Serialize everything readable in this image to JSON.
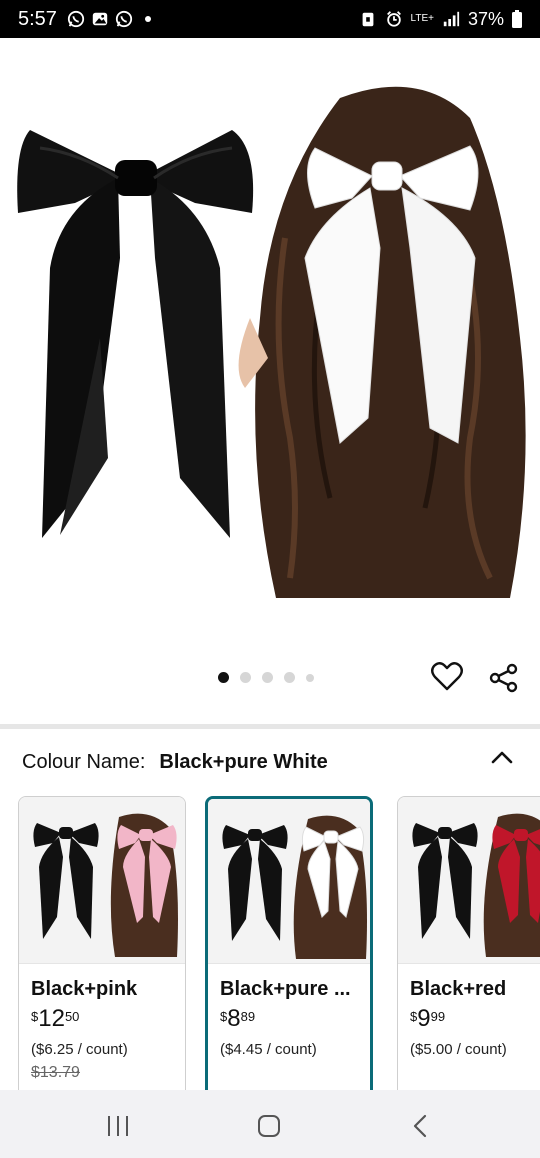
{
  "status_bar": {
    "time": "5:57",
    "network": "LTE+",
    "battery": "37%"
  },
  "carousel": {
    "total_dots": 5,
    "active_index": 0
  },
  "colour_selector": {
    "label": "Colour Name:",
    "selected_value": "Black+pure White"
  },
  "variants": [
    {
      "name": "Black+pink",
      "price_currency": "$",
      "price_whole": "12",
      "price_fraction": "50",
      "unit_price": "($6.25 / count)",
      "list_price": "$13.79",
      "bow_color": "#f2b6c8",
      "selected": false
    },
    {
      "name": "Black+pure ...",
      "price_currency": "$",
      "price_whole": "8",
      "price_fraction": "89",
      "unit_price": "($4.45 / count)",
      "list_price": "",
      "bow_color": "#ffffff",
      "selected": true
    },
    {
      "name": "Black+red",
      "price_currency": "$",
      "price_whole": "9",
      "price_fraction": "99",
      "unit_price": "($5.00 / count)",
      "list_price": "",
      "bow_color": "#c0162a",
      "selected": false
    }
  ],
  "colors": {
    "selected_border": "#0b6b78",
    "divider": "#e6e6e6",
    "nav_bar": "#f2f2f4"
  },
  "icons": {
    "favorite": "heart-icon",
    "share": "share-icon",
    "collapse": "chevron-up-icon",
    "nav_recents": "recents-icon",
    "nav_home": "home-icon",
    "nav_back": "back-icon"
  }
}
